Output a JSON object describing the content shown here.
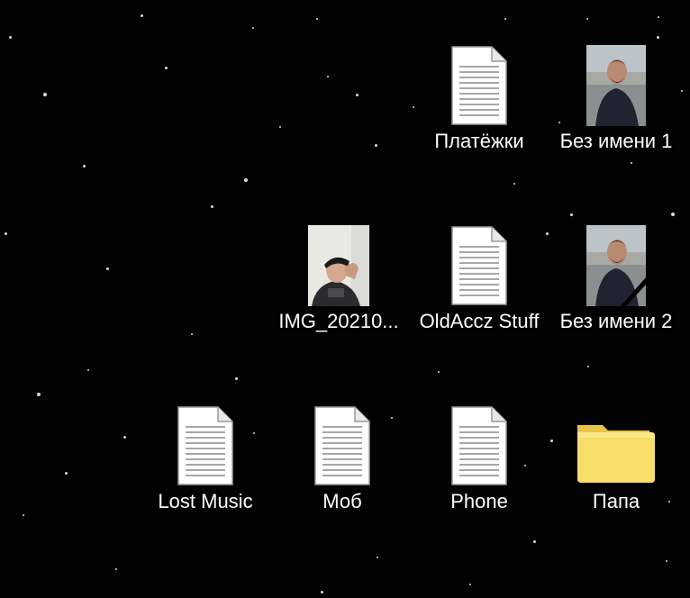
{
  "desktop": {
    "icons": [
      {
        "label": "Платёжки",
        "type": "document-icon"
      },
      {
        "label": "Без имени 1",
        "type": "image-thumbnail-icon"
      },
      {
        "label": "IMG_20210...",
        "type": "image-thumbnail-icon"
      },
      {
        "label": "OldAccz Stuff",
        "type": "document-icon"
      },
      {
        "label": "Без имени 2",
        "type": "image-thumbnail-icon"
      },
      {
        "label": "Lost Music",
        "type": "document-icon"
      },
      {
        "label": "Моб",
        "type": "document-icon"
      },
      {
        "label": "Phone",
        "type": "document-icon"
      },
      {
        "label": "Папа",
        "type": "folder-icon"
      }
    ],
    "colors": {
      "background": "#020202",
      "label_text": "#ffffff",
      "folder": "#f7dd6a"
    }
  }
}
